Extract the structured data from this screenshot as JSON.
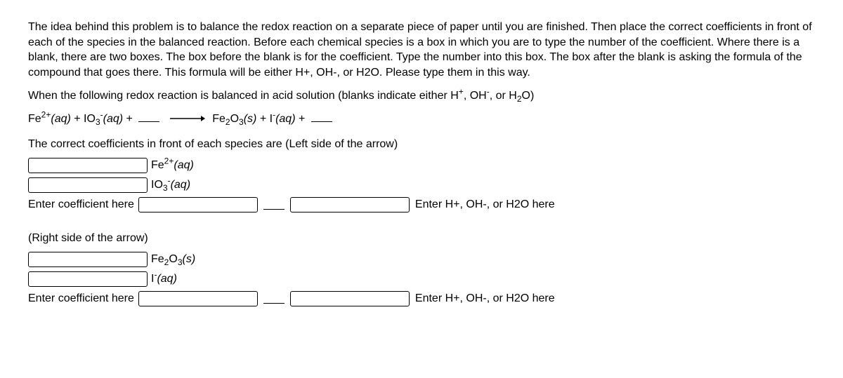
{
  "intro": "The idea behind this problem is to balance the redox reaction on a separate piece of paper until you are finished. Then place the correct coefficients in front of each of the species in the balanced reaction. Before each chemical species is a box in which you are to type the number of the coefficient. Where there is a blank, there are two boxes. The box before the blank is for the coefficient. Type the number into this box. The box after the blank is asking the formula of the compound that goes there. This formula will be either H+, OH-, or H2O. Please type them in this way.",
  "condition_prefix": "When the following redox reaction is balanced in acid solution (blanks indicate either H",
  "condition_mid1": ", OH",
  "condition_mid2": ", or H",
  "condition_suffix": "O)",
  "eq_fe": "Fe",
  "eq_aq": "(aq)",
  "eq_io": " + IO",
  "eq_plus": " + ",
  "eq_feo": "Fe",
  "eq_o": "O",
  "eq_s": "(s)",
  "eq_i": " + I",
  "section_left": "The correct coefficients in front of each species are (Left side of the arrow)",
  "section_right": "(Right side of the arrow)",
  "label_enter_coef": "Enter coefficient here",
  "label_enter_species": "Enter H+, OH-, or H2O here",
  "sp_fe2": "Fe",
  "sp_fe2_aq": "(aq)",
  "sp_io3": "IO",
  "sp_io3_aq": "(aq)",
  "sp_fe2o3": "Fe",
  "sp_fe2o3_s": "(s)",
  "sp_i": "I",
  "sp_i_aq": "(aq)",
  "sup_2plus": "2+",
  "sup_plus": "+",
  "sup_minus": "-",
  "sub_2": "2",
  "sub_3": "3"
}
